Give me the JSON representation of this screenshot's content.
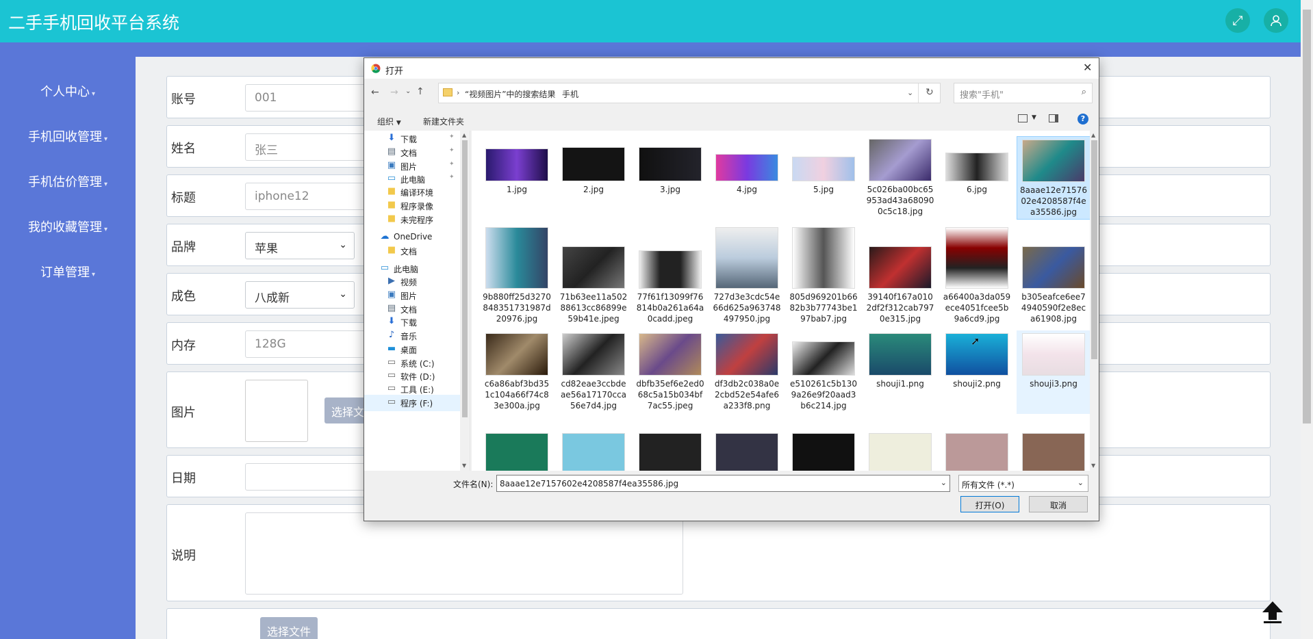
{
  "app": {
    "title": "二手手机回收平台系统"
  },
  "header": {
    "fullscreen_icon": "fullscreen-icon",
    "user_icon": "user-icon"
  },
  "sidebar": {
    "items": [
      {
        "label": "个人中心"
      },
      {
        "label": "手机回收管理"
      },
      {
        "label": "手机估价管理"
      },
      {
        "label": "我的收藏管理"
      },
      {
        "label": "订单管理"
      }
    ]
  },
  "form": {
    "account_label": "账号",
    "account_value": "001",
    "name_label": "姓名",
    "name_value": "张三",
    "title_label": "标题",
    "title_value": "iphone12",
    "brand_label": "品牌",
    "brand_value": "苹果",
    "condition_label": "成色",
    "condition_value": "八成新",
    "memory_label": "内存",
    "memory_value": "128G",
    "image_label": "图片",
    "choose_file_partial": "选择文",
    "date_label": "日期",
    "desc_label": "说明",
    "choose_file_label": "选择文件"
  },
  "dialog": {
    "title": "打开",
    "breadcrumb": [
      "“视频图片”中的搜索结果",
      "手机"
    ],
    "search_placeholder": "搜索\"手机\"",
    "toolbar": {
      "organize": "组织",
      "new_folder": "新建文件夹"
    },
    "nav": [
      {
        "label": "下载",
        "icon": "download-arrow-icon"
      },
      {
        "label": "文档",
        "icon": "document-icon"
      },
      {
        "label": "图片",
        "icon": "picture-icon"
      },
      {
        "label": "此电脑",
        "icon": "computer-icon"
      },
      {
        "label": "编译环境",
        "icon": "folder-icon"
      },
      {
        "label": "程序录像",
        "icon": "folder-icon"
      },
      {
        "label": "未完程序",
        "icon": "folder-icon"
      },
      {
        "label": "OneDrive",
        "icon": "cloud-icon"
      },
      {
        "label": "文档",
        "icon": "folder-icon"
      },
      {
        "label": "此电脑",
        "icon": "computer-icon"
      },
      {
        "label": "视频",
        "icon": "video-icon"
      },
      {
        "label": "图片",
        "icon": "picture-icon"
      },
      {
        "label": "文档",
        "icon": "document-icon"
      },
      {
        "label": "下载",
        "icon": "download-arrow-icon"
      },
      {
        "label": "音乐",
        "icon": "music-icon"
      },
      {
        "label": "桌面",
        "icon": "desktop-icon"
      },
      {
        "label": "系统 (C:)",
        "icon": "drive-icon"
      },
      {
        "label": "软件 (D:)",
        "icon": "drive-icon"
      },
      {
        "label": "工具 (E:)",
        "icon": "drive-icon"
      },
      {
        "label": "程序 (F:)",
        "icon": "drive-icon"
      }
    ],
    "files": [
      {
        "name": "1.jpg"
      },
      {
        "name": "2.jpg"
      },
      {
        "name": "3.jpg"
      },
      {
        "name": "4.jpg"
      },
      {
        "name": "5.jpg"
      },
      {
        "name": "5c026ba00bc65953ad43a680900c5c18.jpg"
      },
      {
        "name": "6.jpg"
      },
      {
        "name": "8aaae12e7157602e4208587f4ea35586.jpg"
      },
      {
        "name": "9b880ff25d3270848351731987d20976.jpg"
      },
      {
        "name": "71b63ee11a50288613cc86899e59b41e.jpeg"
      },
      {
        "name": "77f61f13099f76814b0a261a64a0cadd.jpeg"
      },
      {
        "name": "727d3e3cdc54e66d625a963748497950.jpg"
      },
      {
        "name": "805d969201b6682b3b77743be197bab7.jpg"
      },
      {
        "name": "39140f167a0102df2f312cab7970e315.jpg"
      },
      {
        "name": "a66400a3da059ece4051fcee5b9a6cd9.jpg"
      },
      {
        "name": "b305eafce6ee74940590f2e8eca61908.jpg"
      },
      {
        "name": "c6a86abf3bd351c104a66f74c83e300a.jpg"
      },
      {
        "name": "cd82eae3ccbdeae56a17170cca56e7d4.jpg"
      },
      {
        "name": "dbfb35ef6e2ed068c5a15b034bf7ac55.jpeg"
      },
      {
        "name": "df3db2c038a0e2cbd52e54afe6a233f8.png"
      },
      {
        "name": "e510261c5b1309a26e9f20aad3b6c214.jpg"
      },
      {
        "name": "shouji1.png"
      },
      {
        "name": "shouji2.png"
      },
      {
        "name": "shouji3.png"
      }
    ],
    "filename_label": "文件名(N):",
    "filename_value": "8aaae12e7157602e4208587f4ea35586.jpg",
    "filetype_value": "所有文件 (*.*)",
    "open_button": "打开(O)",
    "cancel_button": "取消"
  },
  "colors": {
    "header": "#1bc4d3",
    "sidebar": "#5a77d8",
    "selection": "#cce8ff"
  }
}
